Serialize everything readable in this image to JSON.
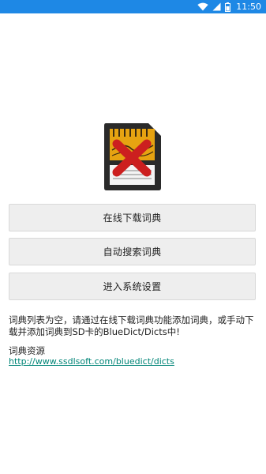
{
  "status_bar": {
    "time": "11:50",
    "icons": [
      "wifi-icon",
      "signal-icon",
      "battery-icon"
    ],
    "background": "#1e88e5"
  },
  "main": {
    "illustration": "sd-card-error-icon",
    "buttons": [
      {
        "label": "在线下载词典"
      },
      {
        "label": "自动搜索词典"
      },
      {
        "label": "进入系统设置"
      }
    ],
    "message": "词典列表为空，请通过在线下载词典功能添加词典，或手动下载并添加词典到SD卡的BlueDict/Dicts中!",
    "resources_title": "词典资源",
    "resources_link": "http://www.ssdlsoft.com/bluedict/dicts",
    "link_color": "#008577"
  }
}
